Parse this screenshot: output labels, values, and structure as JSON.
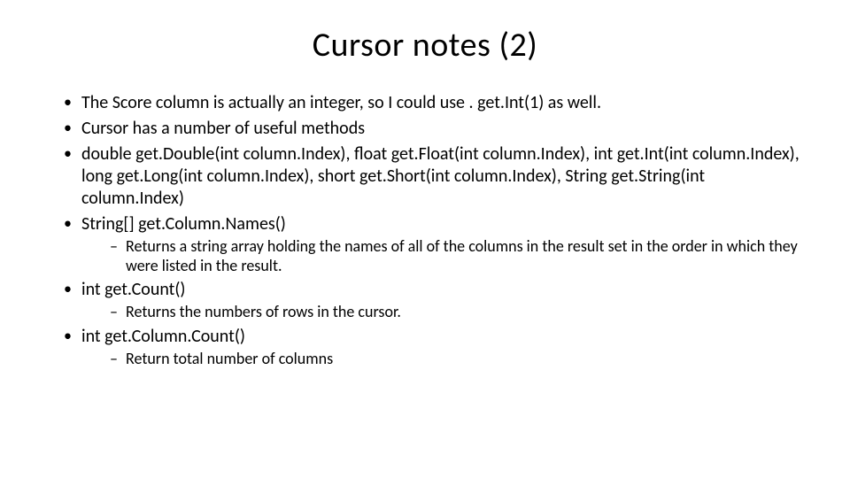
{
  "title": "Cursor notes (2)",
  "bullets": [
    {
      "text": "The Score column is actually an integer, so I could use . get.Int(1) as well."
    },
    {
      "text": "Cursor has a number of useful methods"
    },
    {
      "text": "double get.Double(int column.Index), float get.Float(int column.Index), int get.Int(int column.Index),  long get.Long(int column.Index),  short get.Short(int column.Index), String get.String(int column.Index)"
    },
    {
      "text": "String[] get.Column.Names()",
      "sub": [
        "Returns a string array holding the names of all of the columns in the result set in the order in which they were listed in the result."
      ]
    },
    {
      "text": "int get.Count()",
      "sub": [
        "Returns the numbers of rows in the cursor."
      ]
    },
    {
      "text": "int get.Column.Count()",
      "sub": [
        "Return total number of columns"
      ]
    }
  ]
}
